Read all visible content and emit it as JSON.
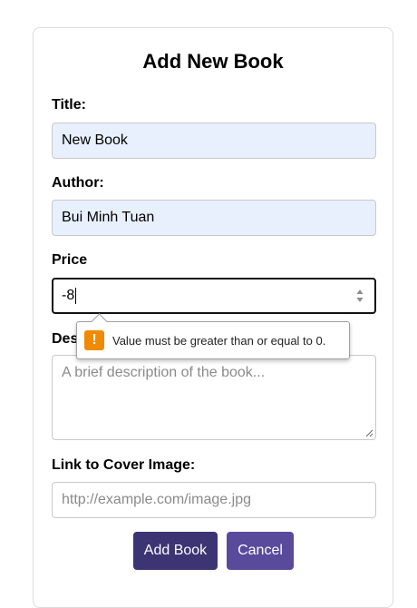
{
  "form": {
    "title": "Add New Book",
    "title_label": "Title:",
    "title_value": "New Book",
    "author_label": "Author:",
    "author_value": "Bui Minh Tuan",
    "price_label": "Price",
    "price_value": "-8",
    "description_label_visible": "Des",
    "description_placeholder": "A brief description of the book...",
    "cover_label": "Link to Cover Image:",
    "cover_placeholder": "http://example.com/image.jpg",
    "add_button": "Add Book",
    "cancel_button": "Cancel"
  },
  "validation": {
    "message": "Value must be greater than or equal to 0.",
    "icon": "warning-icon",
    "icon_glyph": "!"
  },
  "colors": {
    "autofill_bg": "#e8f0fe",
    "add_button_bg": "#3d3474",
    "cancel_button_bg": "#5a4a9c",
    "warning_orange": "#f08a00"
  }
}
